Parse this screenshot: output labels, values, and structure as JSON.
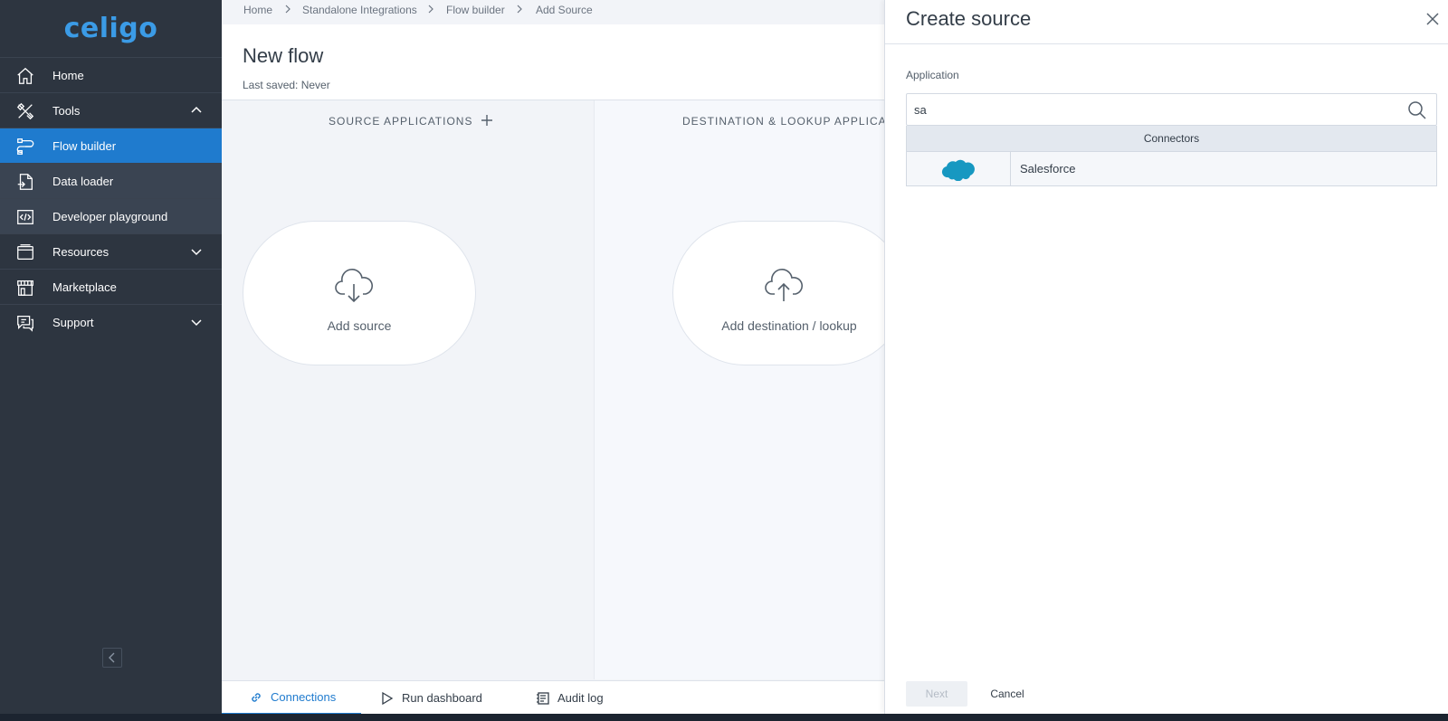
{
  "app": {
    "logo_text": "celigo"
  },
  "sidebar": {
    "items": [
      {
        "label": "Home",
        "icon": "home-icon"
      },
      {
        "label": "Tools",
        "icon": "tools-icon",
        "expanded": true
      },
      {
        "label": "Flow builder",
        "icon": "flow-builder-icon",
        "active": true
      },
      {
        "label": "Data loader",
        "icon": "data-loader-icon"
      },
      {
        "label": "Developer playground",
        "icon": "code-icon"
      },
      {
        "label": "Resources",
        "icon": "resources-icon",
        "expanded": false
      },
      {
        "label": "Marketplace",
        "icon": "marketplace-icon"
      },
      {
        "label": "Support",
        "icon": "support-icon",
        "expanded": false
      }
    ]
  },
  "breadcrumb": [
    "Home",
    "Standalone Integrations",
    "Flow builder",
    "Add Source"
  ],
  "header": {
    "title": "New flow",
    "last_saved": "Last saved: Never"
  },
  "columns": {
    "source_heading": "SOURCE APPLICATIONS",
    "dest_heading": "DESTINATION & LOOKUP APPLICATIONS",
    "add_source": "Add source",
    "add_destination": "Add destination / lookup"
  },
  "bottom_tabs": [
    {
      "label": "Connections",
      "active": true
    },
    {
      "label": "Run dashboard"
    },
    {
      "label": "Audit log"
    }
  ],
  "drawer": {
    "title": "Create source",
    "application_label": "Application",
    "search_value": "sa",
    "results_header": "Connectors",
    "result_label": "Salesforce",
    "result_logo_text": "salesforce",
    "next_label": "Next",
    "cancel_label": "Cancel"
  },
  "colors": {
    "accent": "#1f7bce",
    "sidebar": "#2d3540",
    "salesforce_blue": "#1798c1"
  }
}
